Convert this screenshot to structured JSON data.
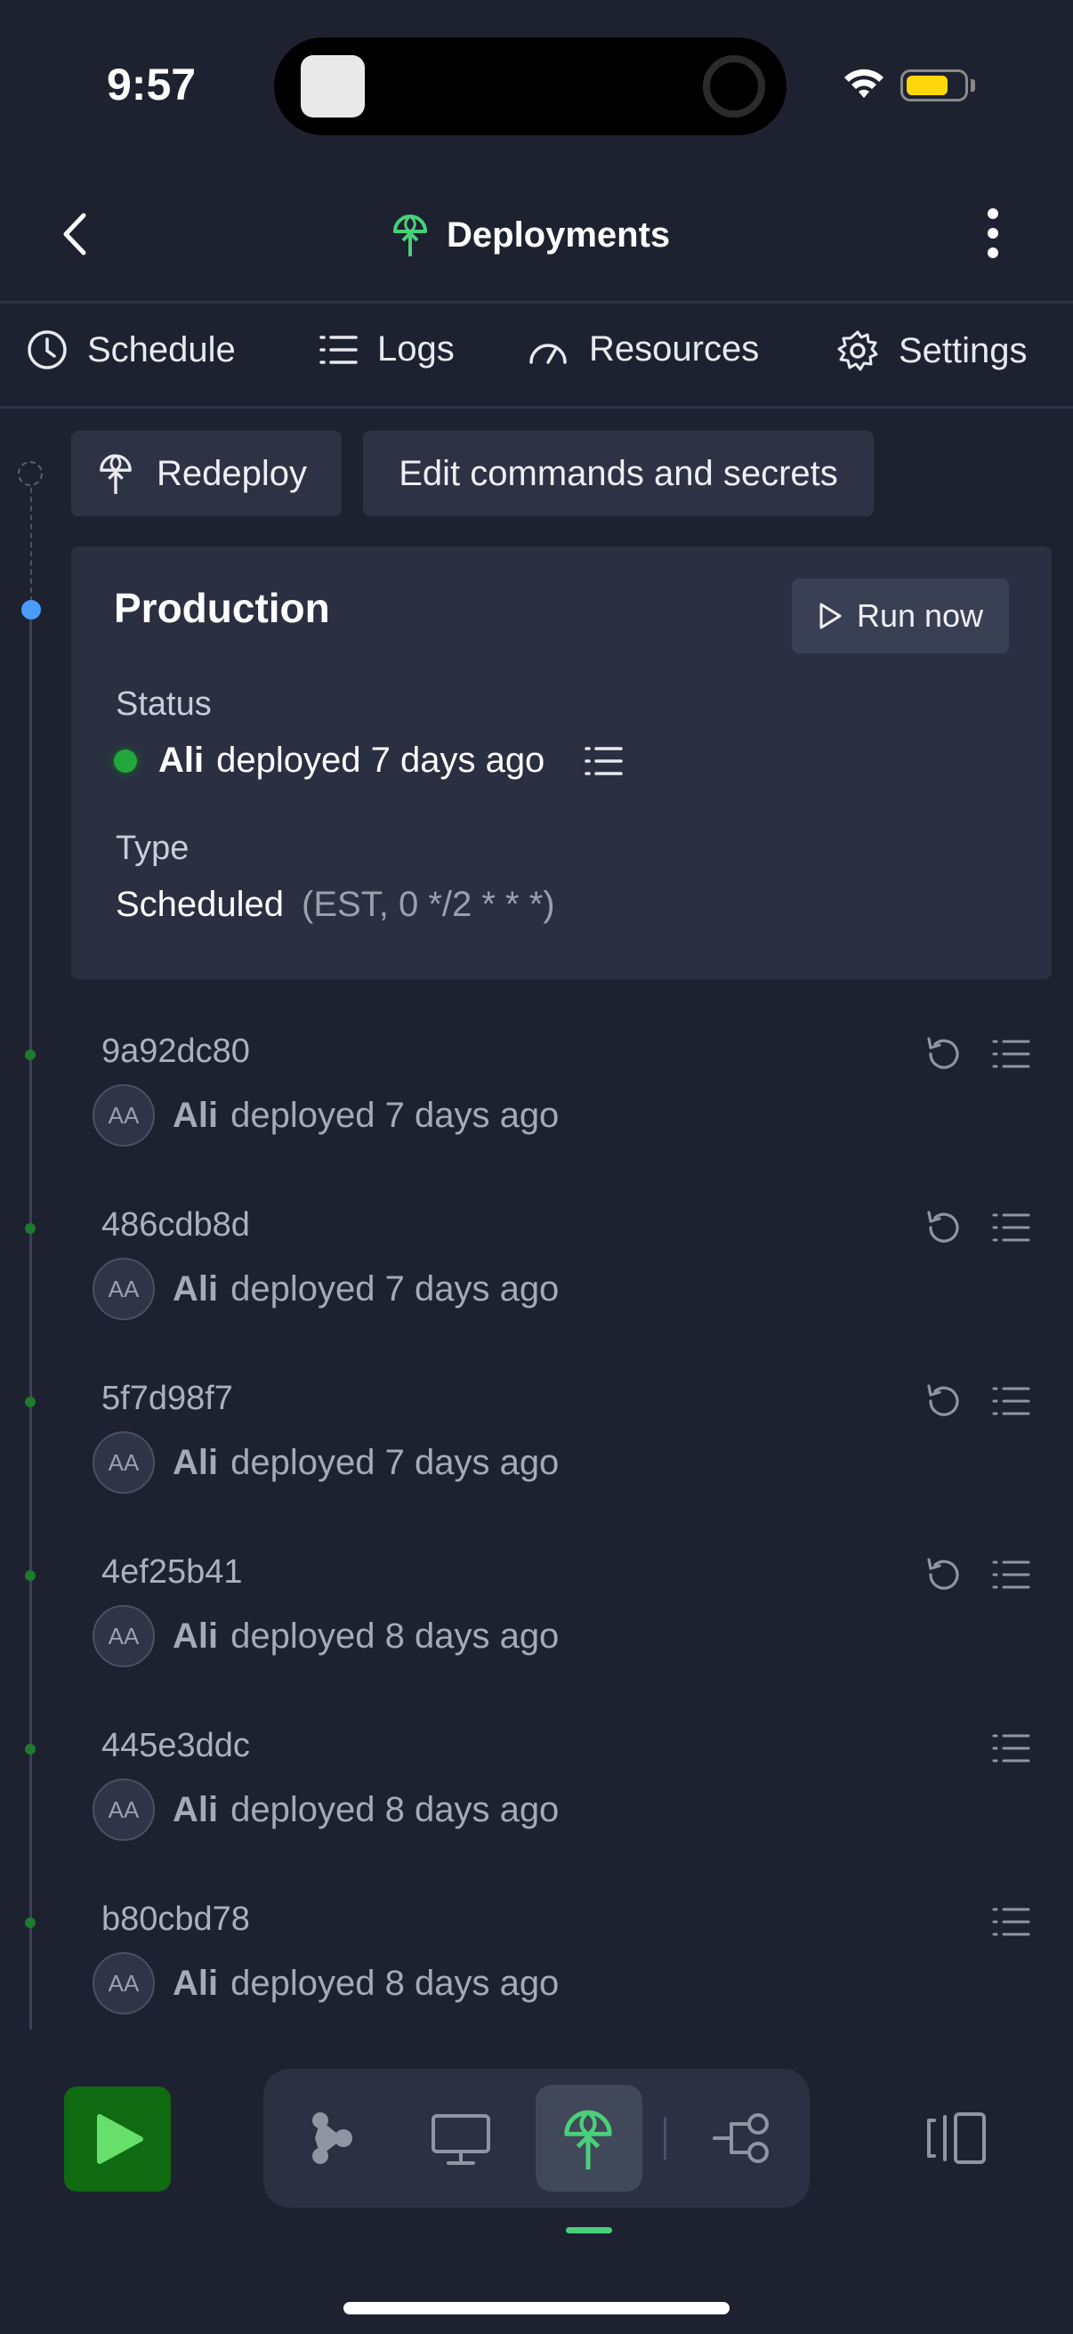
{
  "status_bar": {
    "time": "9:57"
  },
  "header": {
    "title": "Deployments"
  },
  "tabs": [
    {
      "label": "Schedule"
    },
    {
      "label": "Logs"
    },
    {
      "label": "Resources"
    },
    {
      "label": "Settings"
    }
  ],
  "actions": {
    "redeploy": "Redeploy",
    "edit": "Edit commands and secrets"
  },
  "production": {
    "title": "Production",
    "run_now": "Run now",
    "status_label": "Status",
    "status_user": "Ali",
    "status_text": "deployed 7 days ago",
    "type_label": "Type",
    "type_value": "Scheduled",
    "type_detail": "(EST, 0 */2 * * *)"
  },
  "deployments": [
    {
      "hash": "9a92dc80",
      "initials": "AA",
      "user": "Ali",
      "text": "deployed 7 days ago",
      "rollback": true
    },
    {
      "hash": "486cdb8d",
      "initials": "AA",
      "user": "Ali",
      "text": "deployed 7 days ago",
      "rollback": true
    },
    {
      "hash": "5f7d98f7",
      "initials": "AA",
      "user": "Ali",
      "text": "deployed 7 days ago",
      "rollback": true
    },
    {
      "hash": "4ef25b41",
      "initials": "AA",
      "user": "Ali",
      "text": "deployed 8 days ago",
      "rollback": true
    },
    {
      "hash": "445e3ddc",
      "initials": "AA",
      "user": "Ali",
      "text": "deployed 8 days ago",
      "rollback": false
    },
    {
      "hash": "b80cbd78",
      "initials": "AA",
      "user": "Ali",
      "text": "deployed 8 days ago",
      "rollback": false
    }
  ],
  "colors": {
    "accent_green": "#4ad07a",
    "status_green": "#22a83a",
    "timeline_blue": "#4a9cff",
    "run_green": "#0f6a12"
  }
}
